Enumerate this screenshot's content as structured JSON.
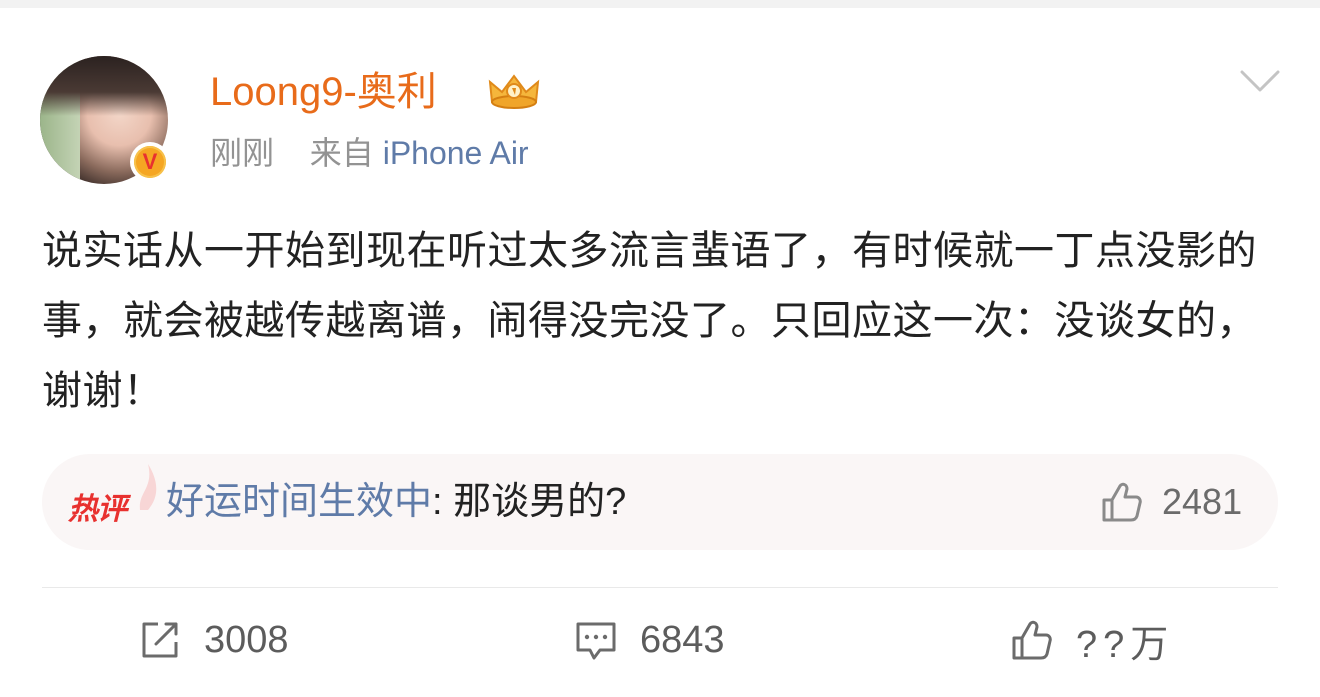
{
  "post": {
    "username": "Loong9-奥利",
    "time": "刚刚",
    "source_prefix": "来自",
    "source_device": "iPhone Air",
    "text": "说实话从一开始到现在听过太多流言蜚语了，有时候就一丁点没影的事，就会被越传越离谱，闹得没完没了。只回应这一次：没谈女的，谢谢！",
    "badges": {
      "verified_icon": "verified-v-icon",
      "crown_icon": "crown-member-icon"
    }
  },
  "hot_comment": {
    "label": "热评",
    "author": "好运时间生效中",
    "separator": ": ",
    "text": "那谈男的?",
    "like_count": "2481"
  },
  "actions": {
    "repost_count": "3008",
    "comment_count": "6843",
    "like_count": "??万"
  },
  "colors": {
    "username": "#e86b1a",
    "link": "#5f7ba8",
    "hot_label": "#e8312f"
  }
}
